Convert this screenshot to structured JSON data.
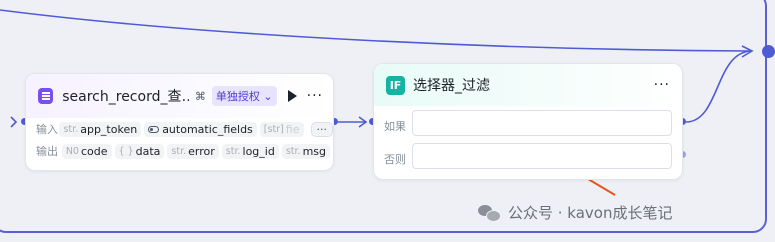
{
  "search_node": {
    "title": "search_record_查…",
    "auth_badge": "单独授权 ⌄",
    "input_label": "输入",
    "output_label": "输出",
    "inputs": [
      {
        "type": "str.",
        "name": "app_token"
      },
      {
        "type": "",
        "name": "automatic_fields",
        "icon": "toggle-icon"
      },
      {
        "type": "[str]",
        "name": "fie",
        "faded": true
      }
    ],
    "more_chip": "···",
    "outputs": [
      {
        "type": "N0",
        "name": "code"
      },
      {
        "type": "{ }",
        "name": "data"
      },
      {
        "type": "str.",
        "name": "error"
      },
      {
        "type": "str.",
        "name": "log_id"
      },
      {
        "type": "str.",
        "name": "msg"
      }
    ]
  },
  "if_node": {
    "icon_text": "IF",
    "title": "选择器_过滤",
    "branches": [
      {
        "label": "如果"
      },
      {
        "label": "否则"
      }
    ]
  },
  "watermark": {
    "text": "公众号 · kavon成长笔记"
  },
  "colors": {
    "wire": "#4f5bd5",
    "annotation_arrow": "#e8541d",
    "if_accent": "#15b3a3",
    "plugin_accent": "#7a4ff0"
  }
}
